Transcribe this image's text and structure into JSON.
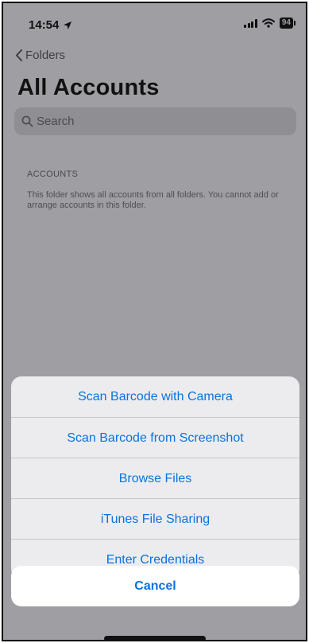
{
  "status_bar": {
    "time": "14:54",
    "battery": "94",
    "location_icon": "location-arrow-icon",
    "signal_icon": "cellular-signal-icon",
    "wifi_icon": "wifi-icon"
  },
  "nav": {
    "back_label": "Folders",
    "back_icon": "chevron-left-icon"
  },
  "page": {
    "title": "All Accounts"
  },
  "search": {
    "placeholder": "Search",
    "icon": "search-icon"
  },
  "accounts_section": {
    "header": "ACCOUNTS",
    "footer": "This folder shows all accounts from all folders. You cannot add or arrange accounts in this folder."
  },
  "action_sheet": {
    "items": [
      {
        "label": "Scan Barcode with Camera"
      },
      {
        "label": "Scan Barcode from Screenshot"
      },
      {
        "label": "Browse Files"
      },
      {
        "label": "iTunes File Sharing"
      },
      {
        "label": "Enter Credentials"
      }
    ],
    "cancel_label": "Cancel"
  },
  "colors": {
    "accent": "#0a72e0",
    "dim_overlay": "#9e9ea3",
    "sheet_background": "#ececef"
  }
}
